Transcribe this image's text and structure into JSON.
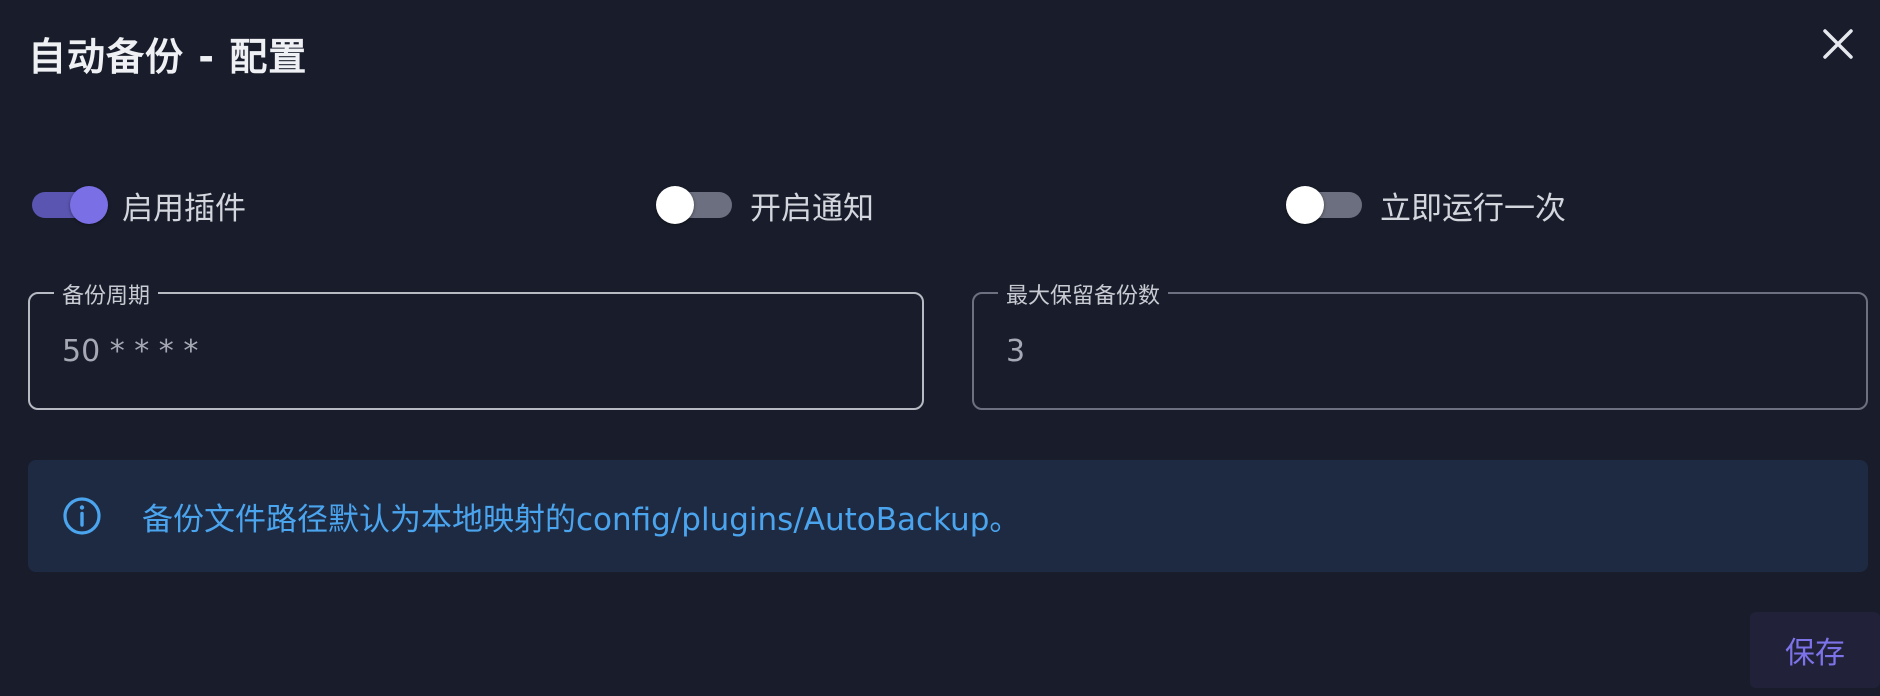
{
  "dialog": {
    "title": "自动备份 - 配置",
    "close_icon": "close-icon"
  },
  "toggles": [
    {
      "label": "启用插件",
      "on": true
    },
    {
      "label": "开启通知",
      "on": false
    },
    {
      "label": "立即运行一次",
      "on": false
    }
  ],
  "fields": {
    "backup_cycle": {
      "label": "备份周期",
      "value": "50 * * * *"
    },
    "max_backups": {
      "label": "最大保留备份数",
      "value": "3"
    }
  },
  "alert": {
    "icon": "info-icon",
    "text": "备份文件路径默认为本地映射的config/plugins/AutoBackup。"
  },
  "actions": {
    "save_label": "保存"
  },
  "colors": {
    "background": "#191d2b",
    "accent": "#7b6fe6",
    "info": "#4ba4ee",
    "alert_bg": "#1d2a42"
  }
}
